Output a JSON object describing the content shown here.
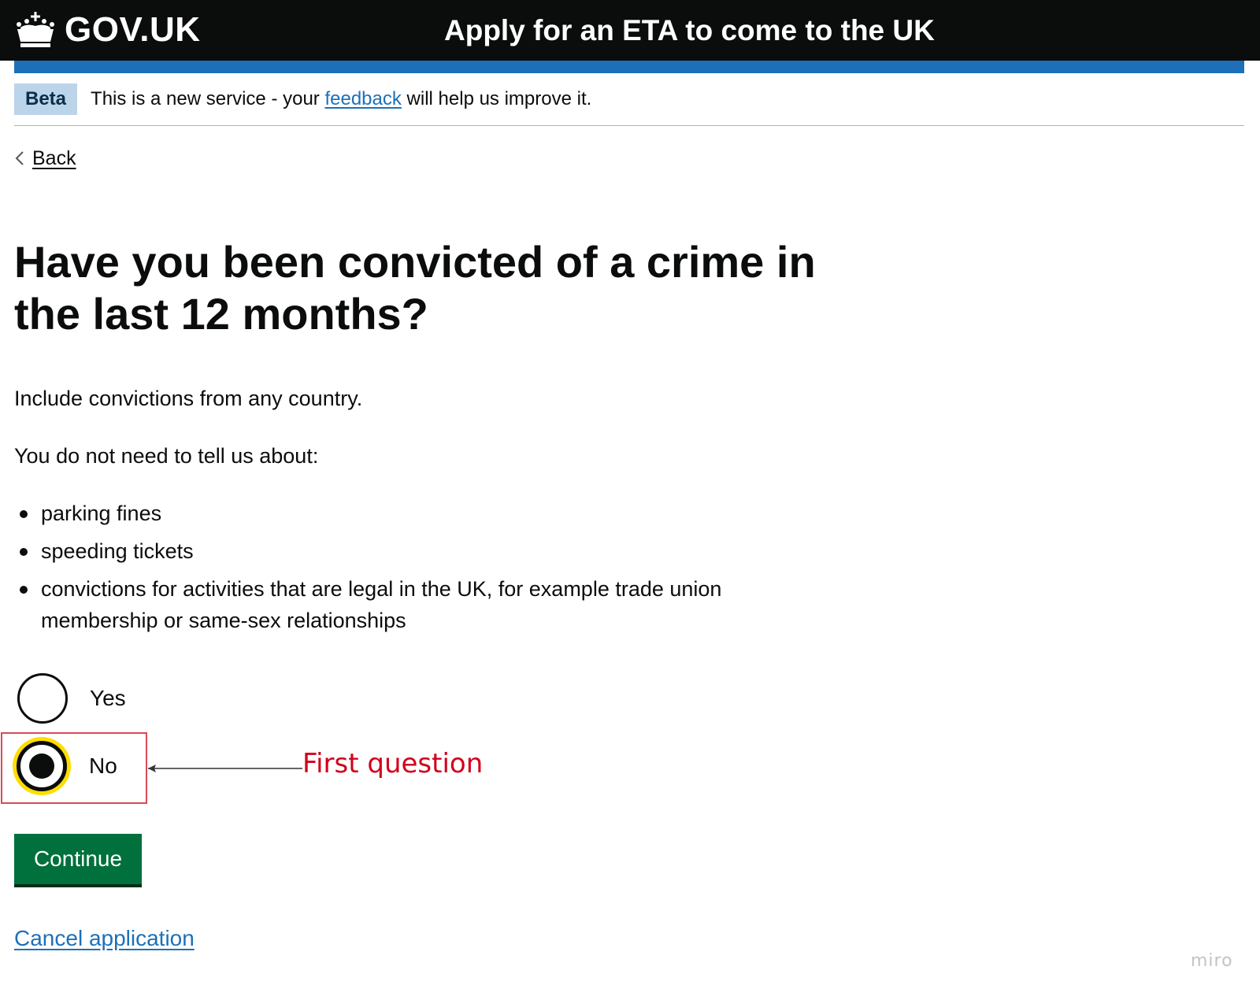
{
  "header": {
    "logo_text": "GOV.UK",
    "logo_icon": "crown-icon",
    "service_name": "Apply for an ETA to come to the UK"
  },
  "phase_banner": {
    "tag": "Beta",
    "text_before": "This is a new service - your",
    "link_text": "feedback",
    "text_after": "will help us improve it."
  },
  "back": {
    "label": "Back",
    "icon": "chevron-left-icon"
  },
  "question": {
    "heading": "Have you been convicted of a crime in the last 12 months?",
    "hint": "Include convictions from any country.",
    "intro": "You do not need to tell us about:",
    "exclusions": [
      "parking fines",
      "speeding tickets",
      "convictions for activities that are legal in the UK, for example trade union membership or same-sex relationships"
    ]
  },
  "options": [
    {
      "label": "Yes",
      "checked": false
    },
    {
      "label": "No",
      "checked": true
    }
  ],
  "annotation": {
    "text": "First question",
    "color": "#d0021b"
  },
  "actions": {
    "continue_label": "Continue",
    "cancel_label": "Cancel application"
  },
  "watermark": "miro",
  "colors": {
    "header_bg": "#0b0c0c",
    "brand_blue": "#1d70b8",
    "button_green": "#00703c",
    "focus_yellow": "#ffdd00",
    "tag_bg": "#bbd4ea"
  }
}
